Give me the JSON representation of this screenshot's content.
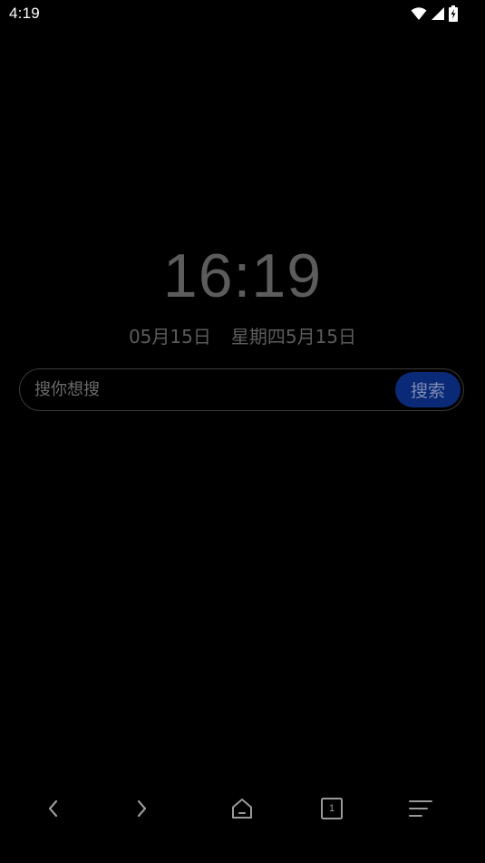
{
  "status_bar": {
    "time": "4:19",
    "icons": [
      "wifi-icon",
      "cellular-signal-icon",
      "battery-charging-icon"
    ]
  },
  "clock": {
    "time": "16:19",
    "date": "05月15日",
    "weekday_date": "星期四5月15日"
  },
  "search": {
    "placeholder": "搜你想搜",
    "value": "",
    "button_label": "搜索"
  },
  "bottom_nav": {
    "items": [
      "back-icon",
      "forward-icon",
      "home-icon",
      "tabs-icon",
      "menu-icon"
    ],
    "tab_count": "1"
  },
  "colors": {
    "background": "#000000",
    "clock_text": "#5c5c5c",
    "search_button": "#0a2a78",
    "icon": "#9a9a9a"
  }
}
